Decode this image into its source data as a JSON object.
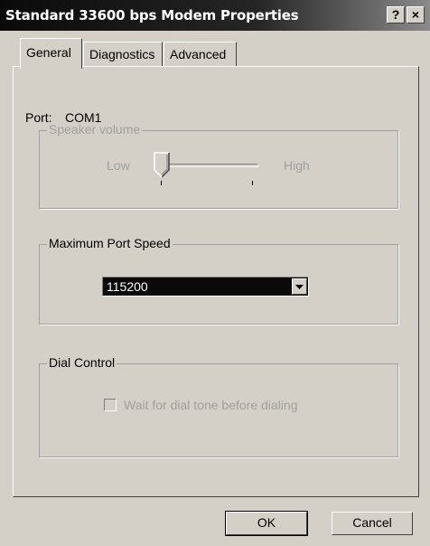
{
  "window": {
    "title": "Standard 33600 bps Modem Properties",
    "help_label": "?",
    "close_label": "×"
  },
  "tabs": [
    {
      "label": "General",
      "active": true
    },
    {
      "label": "Diagnostics",
      "active": false
    },
    {
      "label": "Advanced",
      "active": false
    }
  ],
  "general": {
    "port_label": "Port:",
    "port_value": "COM1",
    "speaker_group": {
      "title": "Speaker volume",
      "low_label": "Low",
      "high_label": "High",
      "enabled": false,
      "slider_level": 0
    },
    "port_speed_group": {
      "title": "Maximum Port Speed",
      "selected_value": "115200"
    },
    "dial_group": {
      "title": "Dial Control",
      "checkbox_label": "Wait for dial tone before dialing",
      "checked": false,
      "enabled": false
    }
  },
  "buttons": {
    "ok_label": "OK",
    "cancel_label": "Cancel"
  },
  "colors": {
    "dialog_face": "#d4d0c8",
    "titlebar": "#0a0a0a",
    "selection": "#0a0a0a",
    "disabled_text": "#a0a0a0"
  }
}
